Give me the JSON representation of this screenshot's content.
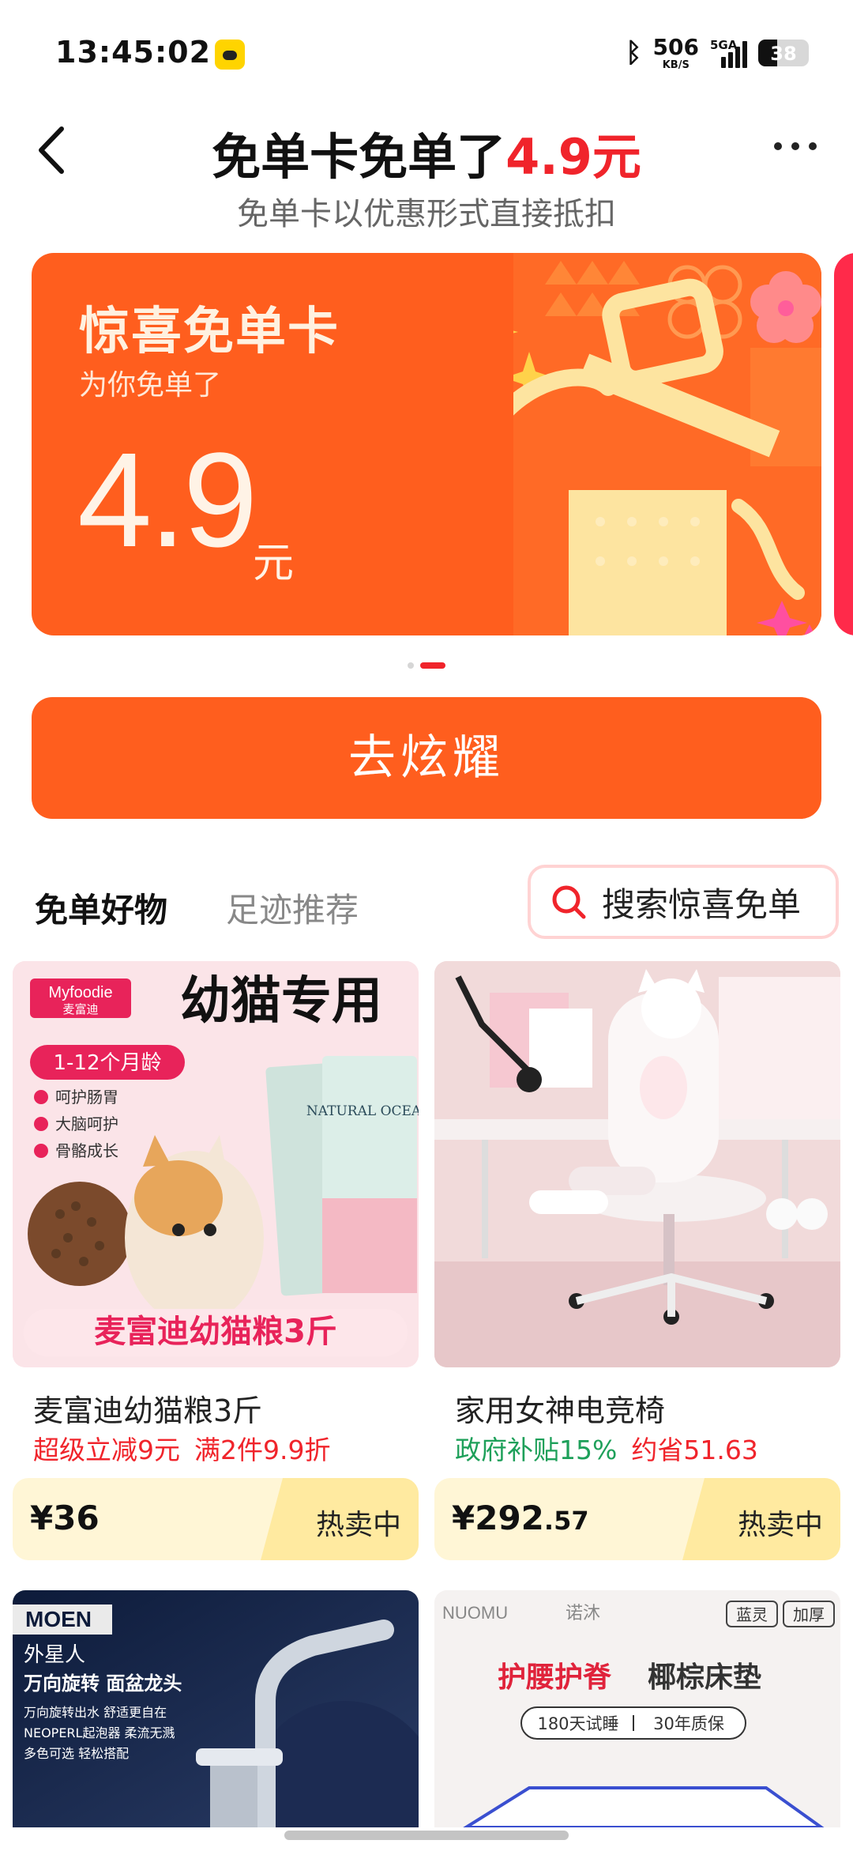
{
  "status_bar": {
    "time": "13:45:02",
    "network_speed": "506",
    "network_unit": "KB/S",
    "signal_label": "5GA",
    "battery": "38"
  },
  "header": {
    "title_main": "免单卡免单了",
    "title_amount": "4.9元",
    "subtitle": "免单卡以优惠形式直接抵扣"
  },
  "card": {
    "label": "惊喜免单卡",
    "sub": "为你免单了",
    "amount": "4.9",
    "unit": "元",
    "colors": {
      "background": "#ff5e1e",
      "gift": "#fde4a0"
    }
  },
  "carousel": {
    "active_index": 1,
    "count": 2
  },
  "cta": {
    "label": "去炫耀"
  },
  "tabs": [
    {
      "label": "免单好物",
      "active": true
    },
    {
      "label": "足迹推荐",
      "active": false
    }
  ],
  "search": {
    "placeholder": "搜索惊喜免单"
  },
  "products": [
    {
      "name": "麦富迪幼猫粮3斤",
      "promos": [
        {
          "text": "超级立减9元",
          "color": "red"
        },
        {
          "text": "满2件9.9折",
          "color": "red"
        }
      ],
      "price_symbol": "¥",
      "price_int": "36",
      "price_dec": "",
      "tag": "热卖中",
      "image": {
        "brand_en": "Myfoodie",
        "brand_cn": "麦富迪",
        "headline": "幼猫专用",
        "age": "1-12个月龄",
        "benefits": [
          "呵护肠胃",
          "大脑呵护",
          "骨骼成长"
        ],
        "package_text": "NATURAL OCEAN",
        "footer": "麦富迪幼猫粮3斤"
      }
    },
    {
      "name": "家用女神电竞椅",
      "promos": [
        {
          "text": "政府补贴15%",
          "color": "green"
        },
        {
          "text": "约省51.63",
          "color": "red"
        }
      ],
      "price_symbol": "¥",
      "price_int": "292",
      "price_dec": ".57",
      "tag": "热卖中",
      "image": {
        "subject": "pink-gaming-chair"
      }
    }
  ],
  "bottom_products": [
    {
      "brand": "MOEN",
      "lines": [
        "外星人",
        "万向旋转 面盆龙头",
        "万向旋转出水 舒适更自在",
        "NEOPERL起泡器 柔流无溅",
        "多色可选 轻松搭配"
      ]
    },
    {
      "brand": "NUOMU",
      "brand_cn": "诺沐",
      "badges": [
        "蓝灵",
        "加厚"
      ],
      "headline_red": "护腰护脊",
      "headline_dark": "椰棕床垫",
      "guarantees": [
        "180天试睡",
        "30年质保"
      ]
    }
  ]
}
